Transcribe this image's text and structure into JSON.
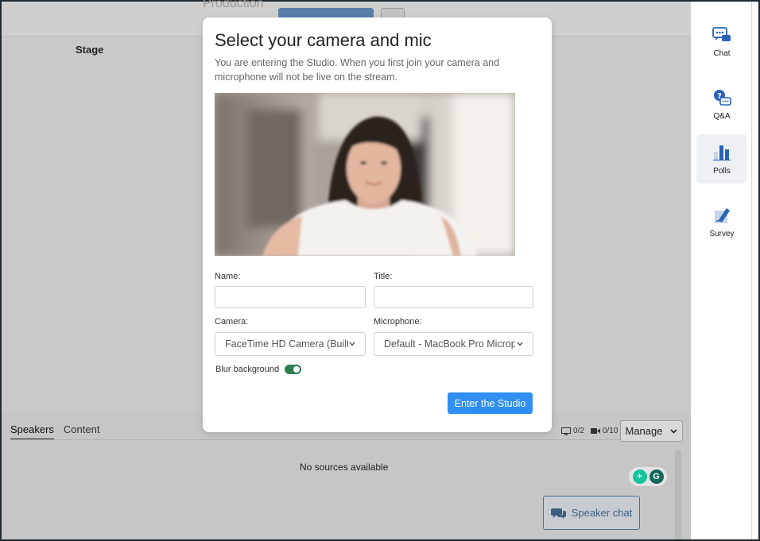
{
  "background": {
    "production_label": "Production",
    "stage_label": "Stage",
    "tabs": [
      {
        "label": "Speakers",
        "active": true
      },
      {
        "label": "Content",
        "active": false
      }
    ],
    "screen_count": "0/2",
    "camera_count": "0/10",
    "manage_label": "Manage",
    "no_sources_text": "No sources available",
    "speaker_chat_label": "Speaker chat"
  },
  "sidebar": {
    "items": [
      {
        "label": "Chat",
        "icon": "chat-bubbles-icon"
      },
      {
        "label": "Q&A",
        "icon": "qa-icon"
      },
      {
        "label": "Polls",
        "icon": "polls-icon",
        "active": true
      },
      {
        "label": "Survey",
        "icon": "survey-icon"
      }
    ]
  },
  "modal": {
    "title": "Select your camera and mic",
    "description": "You are entering the Studio. When you first join your camera and microphone will not be live on the stream.",
    "name_label": "Name:",
    "name_value": "",
    "title_label": "Title:",
    "title_value": "",
    "camera_label": "Camera:",
    "camera_value": "FaceTime HD Camera (Built-in)",
    "microphone_label": "Microphone:",
    "microphone_value": "Default - MacBook Pro Microphone",
    "blur_label": "Blur background",
    "blur_enabled": true,
    "enter_button": "Enter the Studio"
  },
  "colors": {
    "accent": "#2f8ff2",
    "toggle_on": "#2e7d4f",
    "sidebar_icon_blue": "#2a62b8"
  }
}
